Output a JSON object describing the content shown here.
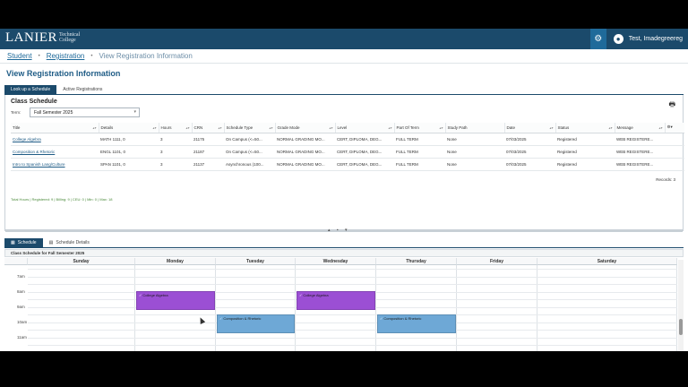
{
  "header": {
    "logo": "LANIER",
    "logo_sub_1": "Technical",
    "logo_sub_2": "College",
    "username": "Test, Imadegreereg",
    "colors": {
      "header_bg": "#1b4a6b",
      "accent": "#1f6a9a"
    }
  },
  "breadcrumb": {
    "items": [
      "Student",
      "Registration"
    ],
    "current": "View Registration Information"
  },
  "page_title": "View Registration Information",
  "main_tabs": [
    {
      "label": "Look up a Schedule",
      "active": true
    },
    {
      "label": "Active Registrations",
      "active": false
    }
  ],
  "class_schedule": {
    "title": "Class Schedule",
    "term_label": "Term:",
    "term_value": "Fall Semester 2025",
    "columns": [
      "Title",
      "Details",
      "Hours",
      "CRN",
      "Schedule Type",
      "Grade Mode",
      "Level",
      "Part Of Term",
      "Study Path",
      "Date",
      "Status",
      "Message"
    ],
    "rows": [
      [
        "College Algebra",
        "MATH 1111, 0",
        "3",
        "21175",
        "On Campus (<=50...",
        "NORMAL GRADING MO...",
        "CERT, DIPLOMA, DEG...",
        "FULL TERM",
        "None",
        "07/03/2025",
        "Registered",
        "WEB REGISTERE..."
      ],
      [
        "Composition & Rhetoric",
        "ENGL 1101, 0",
        "3",
        "21187",
        "On Campus (<=50...",
        "NORMAL GRADING MO...",
        "CERT, DIPLOMA, DEG...",
        "FULL TERM",
        "None",
        "07/03/2025",
        "Registered",
        "WEB REGISTERE..."
      ],
      [
        "Intro to Spanish Lang/Culture",
        "SPAN 1101, 0",
        "3",
        "21137",
        "Asynchronous (100...",
        "NORMAL GRADING MO...",
        "CERT, DIPLOMA, DEG...",
        "FULL TERM",
        "None",
        "07/03/2025",
        "Registered",
        "WEB REGISTERE..."
      ]
    ],
    "records": "Records: 3",
    "totals": "Total Hours | Registered: 9 | Billing: 9 | CEU: 0 | Min: 0 | Max: 18"
  },
  "schedule_tabs": [
    {
      "label": "Schedule",
      "active": true
    },
    {
      "label": "Schedule Details",
      "active": false
    }
  ],
  "schedule_caption": "Class Schedule for Fall Semester 2025",
  "calendar": {
    "days": [
      "Sunday",
      "Monday",
      "Tuesday",
      "Wednesday",
      "Thursday",
      "Friday",
      "Saturday"
    ],
    "times": [
      "7am",
      "8am",
      "9am",
      "10am",
      "11am"
    ],
    "events": [
      {
        "label": "College Algebra",
        "day": "Monday",
        "start": "8am",
        "color": "#9b4fd4"
      },
      {
        "label": "College Algebra",
        "day": "Wednesday",
        "start": "8am",
        "color": "#9b4fd4"
      },
      {
        "label": "Composition & Rhetoric",
        "day": "Tuesday",
        "start": "9:30am",
        "color": "#6ea8d6"
      },
      {
        "label": "Composition & Rhetoric",
        "day": "Thursday",
        "start": "9:30am",
        "color": "#6ea8d6"
      }
    ]
  },
  "icons": {
    "gear": "gear-icon",
    "user": "user-icon",
    "print": "print-icon",
    "settings": "settings-icon"
  }
}
